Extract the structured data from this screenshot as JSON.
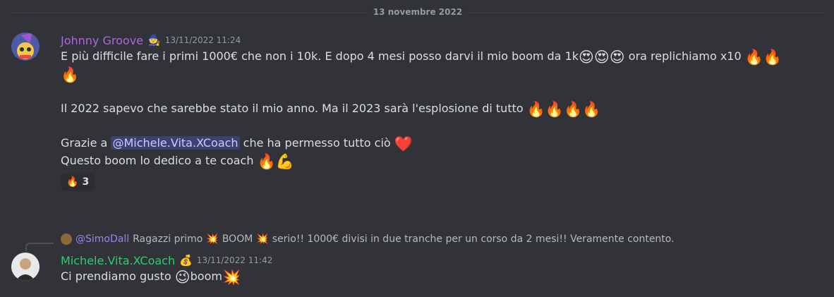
{
  "divider": {
    "date": "13 novembre 2022"
  },
  "messages": [
    {
      "username": "Johnny Groove",
      "username_color": "#a86bd6",
      "role_icon": "wizard-hat",
      "timestamp": "13/11/2022 11:24",
      "lines": {
        "l1": "E più difficile fare i primi 1000€ che non i 10k. E dopo 4 mesi posso darvi il mio boom da 1k",
        "l1b": "ora replichiamo x10",
        "l3": "Il 2022 sapevo che sarebbe stato il mio anno. Ma il 2023 sarà l'esplosione di tutto",
        "l5a": "Grazie a",
        "mention": "@Michele.Vita.XCoach",
        "l5b": "che ha permesso tutto ciò",
        "l6": "Questo boom lo dedico a te coach"
      },
      "emoji": {
        "heart_eyes": "😍😍😍",
        "fire2": "🔥🔥",
        "fire1": "🔥",
        "fire4": "🔥🔥🔥🔥",
        "heart": "❤️",
        "fire_muscle": "🔥💪"
      },
      "reaction": {
        "emoji": "🔥",
        "count": "3"
      }
    },
    {
      "reply": {
        "name": "@SimoDall",
        "text_a": "Ragazzi primo",
        "text_b": "BOOM",
        "text_c": "serio!! 1000€ divisi in due tranche per un corso da 2 mesi!! Veramente contento.",
        "boom": "💥"
      },
      "username": "Michele.Vita.XCoach",
      "username_color": "#2ecc71",
      "role_icon": "money-bag",
      "timestamp": "13/11/2022 11:42",
      "text_a": "Ci prendiamo gusto",
      "wink": "😉",
      "text_b": "boom",
      "boom": "💥"
    }
  ]
}
